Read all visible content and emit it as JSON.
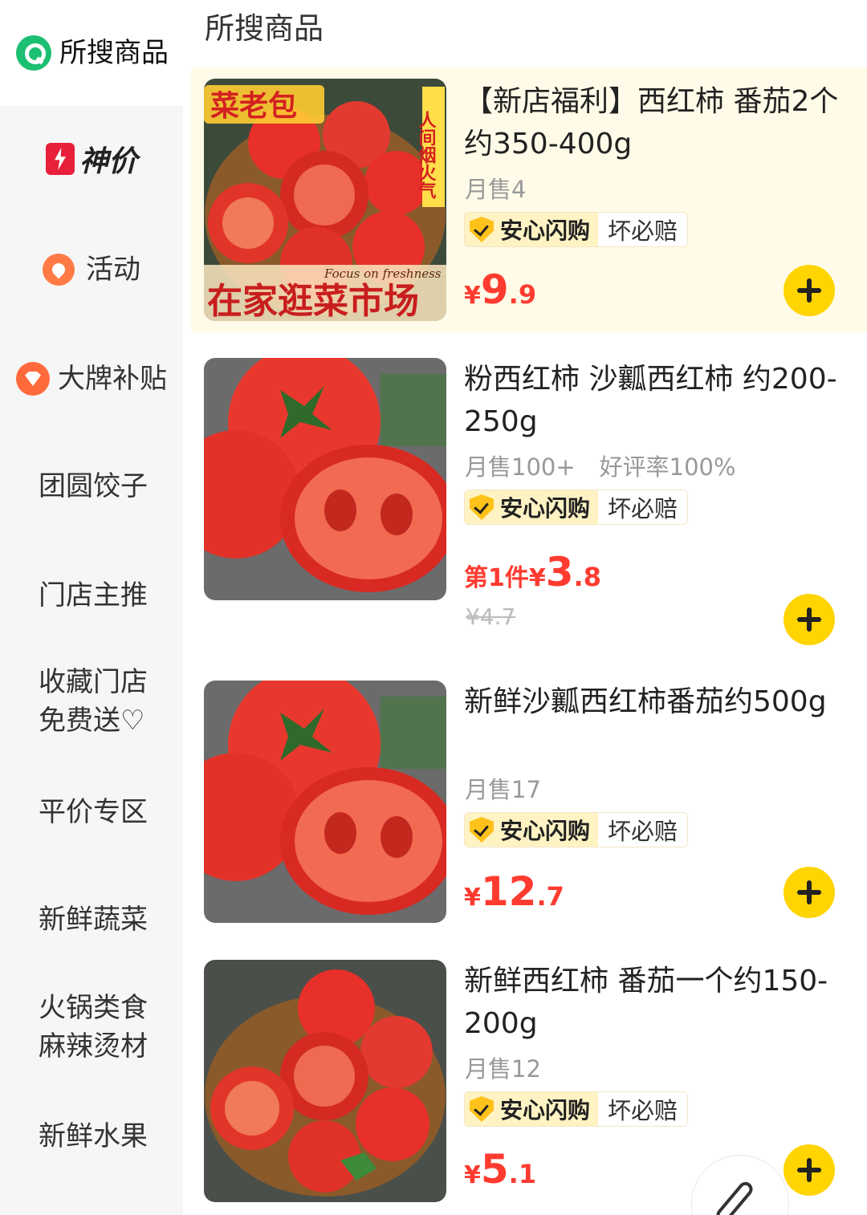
{
  "sidebar": {
    "items": [
      {
        "label": "所搜商品",
        "icon": "search-icon",
        "active": true
      },
      {
        "label": "价",
        "prefix": "神",
        "icon": "lightning-icon"
      },
      {
        "label": "活动",
        "icon": "activity-icon"
      },
      {
        "label": "大牌补贴",
        "icon": "brand-subsidy-icon"
      },
      {
        "label": "团圆饺子"
      },
      {
        "label": "门店主推"
      },
      {
        "label": "收藏门店",
        "label2": "免费送♡"
      },
      {
        "label": "平价专区"
      },
      {
        "label": "新鲜蔬菜"
      },
      {
        "label": "火锅类食",
        "label2": "麻辣烫材"
      },
      {
        "label": "新鲜水果"
      }
    ]
  },
  "main": {
    "title": "所搜商品",
    "products": [
      {
        "name": "【新店福利】西红柿 番茄2个约350-400g",
        "sales": "月售4",
        "badge_main": "安心闪购",
        "badge_sub": "坏必赔",
        "price_yen": "¥",
        "price_int": "9",
        "price_dec": ".9",
        "image_text_1": "菜老包",
        "image_text_2": "在家逛菜市场",
        "image_text_3": "Focus on freshness",
        "image_text_4": "人间烟火气"
      },
      {
        "name": "粉西红柿 沙瓤西红柿 约200-250g",
        "sales": "月售100+",
        "rating": "好评率100%",
        "badge_main": "安心闪购",
        "badge_sub": "坏必赔",
        "price_prefix": "第1件",
        "price_yen": "¥",
        "price_int": "3",
        "price_dec": ".8",
        "original_price": "¥4.7"
      },
      {
        "name": "新鲜沙瓤西红柿番茄约500g",
        "sales": "月售17",
        "badge_main": "安心闪购",
        "badge_sub": "坏必赔",
        "price_yen": "¥",
        "price_int": "12",
        "price_dec": ".7"
      },
      {
        "name": "新鲜西红柿 番茄一个约150-200g",
        "sales": "月售12",
        "badge_main": "安心闪购",
        "badge_sub": "坏必赔",
        "price_yen": "¥",
        "price_int": "5",
        "price_dec": ".1"
      }
    ]
  },
  "colors": {
    "accent_yellow": "#ffd400",
    "price_red": "#ff3b30",
    "highlight_bg": "#fffbe8",
    "sidebar_bg": "#f6f6f6"
  }
}
